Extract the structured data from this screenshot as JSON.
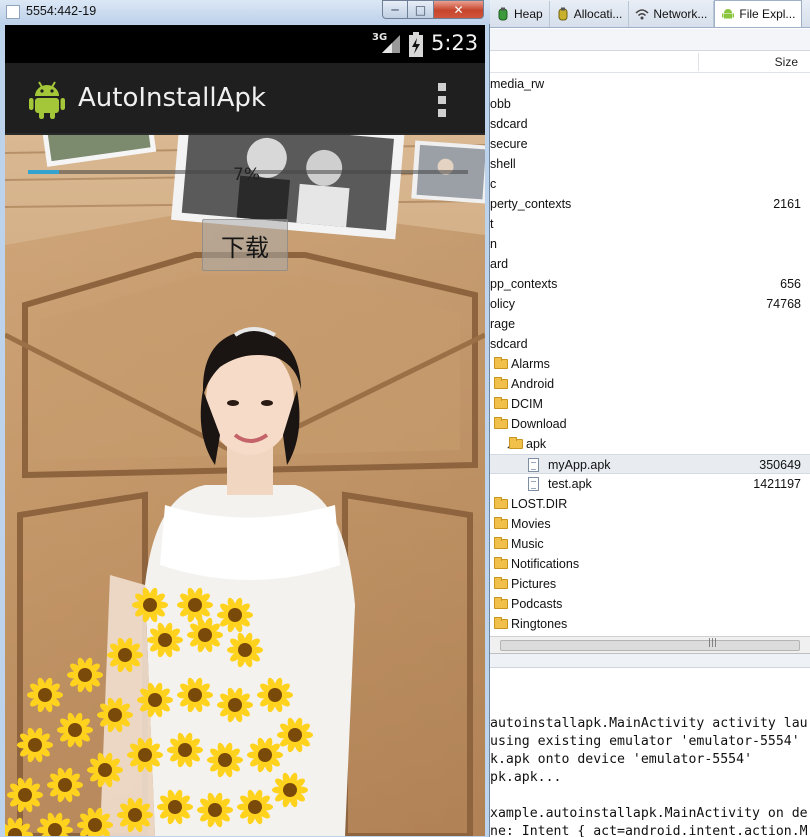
{
  "emulator": {
    "window_title": "5554:442-19",
    "status_network": "3G",
    "status_time": "5:23",
    "app_title": "AutoInstallApk",
    "progress_percent": 7,
    "progress_label": "7%",
    "download_label": "下载"
  },
  "ide": {
    "tabs": [
      {
        "label": "Heap",
        "icon": "heap-icon"
      },
      {
        "label": "Allocati...",
        "icon": "allocation-icon"
      },
      {
        "label": "Network...",
        "icon": "network-icon"
      },
      {
        "label": "File Expl...",
        "icon": "android-icon",
        "active": true
      }
    ],
    "column_size_label": "Size",
    "tree": [
      {
        "name": "media_rw",
        "size": "",
        "indent": 0,
        "type": "none"
      },
      {
        "name": "obb",
        "size": "",
        "indent": 0,
        "type": "none"
      },
      {
        "name": "sdcard",
        "size": "",
        "indent": 0,
        "type": "none"
      },
      {
        "name": "secure",
        "size": "",
        "indent": 0,
        "type": "none"
      },
      {
        "name": "shell",
        "size": "",
        "indent": 0,
        "type": "none"
      },
      {
        "name": "c",
        "size": "",
        "indent": 0,
        "type": "none"
      },
      {
        "name": "perty_contexts",
        "size": "2161",
        "indent": 0,
        "type": "none"
      },
      {
        "name": "t",
        "size": "",
        "indent": 0,
        "type": "none"
      },
      {
        "name": "n",
        "size": "",
        "indent": 0,
        "type": "none"
      },
      {
        "name": "ard",
        "size": "",
        "indent": 0,
        "type": "none"
      },
      {
        "name": "pp_contexts",
        "size": "656",
        "indent": 0,
        "type": "none"
      },
      {
        "name": "olicy",
        "size": "74768",
        "indent": 0,
        "type": "none"
      },
      {
        "name": "rage",
        "size": "",
        "indent": 0,
        "type": "none"
      },
      {
        "name": "sdcard",
        "size": "",
        "indent": 0,
        "type": "none"
      },
      {
        "name": "Alarms",
        "size": "",
        "indent": 1,
        "type": "folder"
      },
      {
        "name": "Android",
        "size": "",
        "indent": 1,
        "type": "folder"
      },
      {
        "name": "DCIM",
        "size": "",
        "indent": 1,
        "type": "folder"
      },
      {
        "name": "Download",
        "size": "",
        "indent": 1,
        "type": "folder"
      },
      {
        "name": "apk",
        "size": "",
        "indent": 2,
        "type": "folder",
        "expanded": true
      },
      {
        "name": "myApp.apk",
        "size": "350649",
        "indent": 3,
        "type": "file",
        "selected": true
      },
      {
        "name": "test.apk",
        "size": "1421197",
        "indent": 3,
        "type": "file"
      },
      {
        "name": "LOST.DIR",
        "size": "",
        "indent": 1,
        "type": "folder"
      },
      {
        "name": "Movies",
        "size": "",
        "indent": 1,
        "type": "folder"
      },
      {
        "name": "Music",
        "size": "",
        "indent": 1,
        "type": "folder"
      },
      {
        "name": "Notifications",
        "size": "",
        "indent": 1,
        "type": "folder"
      },
      {
        "name": "Pictures",
        "size": "",
        "indent": 1,
        "type": "folder"
      },
      {
        "name": "Podcasts",
        "size": "",
        "indent": 1,
        "type": "folder"
      },
      {
        "name": "Ringtones",
        "size": "",
        "indent": 1,
        "type": "folder"
      }
    ],
    "console_lines": [
      "autoinstallapk.MainActivity activity lau",
      "using existing emulator 'emulator-5554'",
      "k.apk onto device 'emulator-5554'",
      "pk.apk...",
      "",
      "xample.autoinstallapk.MainActivity on de",
      "ne: Intent { act=android.intent.action.M"
    ]
  }
}
